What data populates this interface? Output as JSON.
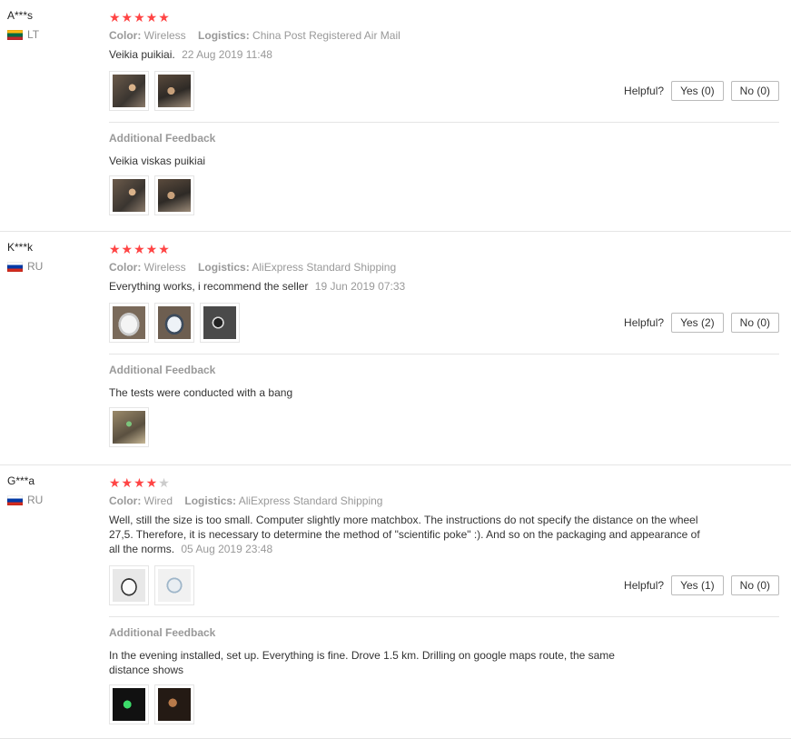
{
  "reviews": [
    {
      "user": "A***s",
      "country": "LT",
      "stars_filled": "★★★★★",
      "stars_empty": "",
      "color_label": "Color:",
      "color_value": "Wireless",
      "logistics_label": "Logistics:",
      "logistics_value": "China Post Registered Air Mail",
      "text": "Veikia puikiai.",
      "date": "22 Aug 2019 11:48",
      "helpful_label": "Helpful?",
      "yes_label": "Yes (0)",
      "no_label": "No (0)",
      "additional_title": "Additional Feedback",
      "additional_text": "Veikia viskas puikiai"
    },
    {
      "user": "K***k",
      "country": "RU",
      "stars_filled": "★★★★★",
      "stars_empty": "",
      "color_label": "Color:",
      "color_value": "Wireless",
      "logistics_label": "Logistics:",
      "logistics_value": "AliExpress Standard Shipping",
      "text": "Everything works, i recommend the seller",
      "date": "19 Jun 2019 07:33",
      "helpful_label": "Helpful?",
      "yes_label": "Yes (2)",
      "no_label": "No (0)",
      "additional_title": "Additional Feedback",
      "additional_text": "The tests were conducted with a bang"
    },
    {
      "user": "G***a",
      "country": "RU",
      "stars_filled": "★★★★",
      "stars_empty": "★",
      "color_label": "Color:",
      "color_value": "Wired",
      "logistics_label": "Logistics:",
      "logistics_value": "AliExpress Standard Shipping",
      "text": "Well, still the size is too small. Computer slightly more matchbox. The instructions do not specify the distance on the wheel 27,5. Therefore, it is necessary to determine the method of \"scientific poke\" :). And so on the packaging and appearance of all the norms.",
      "date": "05 Aug 2019 23:48",
      "helpful_label": "Helpful?",
      "yes_label": "Yes (1)",
      "no_label": "No (0)",
      "additional_title": "Additional Feedback",
      "additional_text": "In the evening installed, set up. Everything is fine. Drove 1.5 km. Drilling on google maps route, the same distance shows"
    }
  ],
  "colors": {
    "star": "#ff4444",
    "star_empty": "#cccccc",
    "meta_text": "#999999",
    "divider": "#e5e5e5"
  },
  "icons": {
    "flag_lt": "flag-lithuania-icon",
    "flag_ru": "flag-russia-icon"
  }
}
